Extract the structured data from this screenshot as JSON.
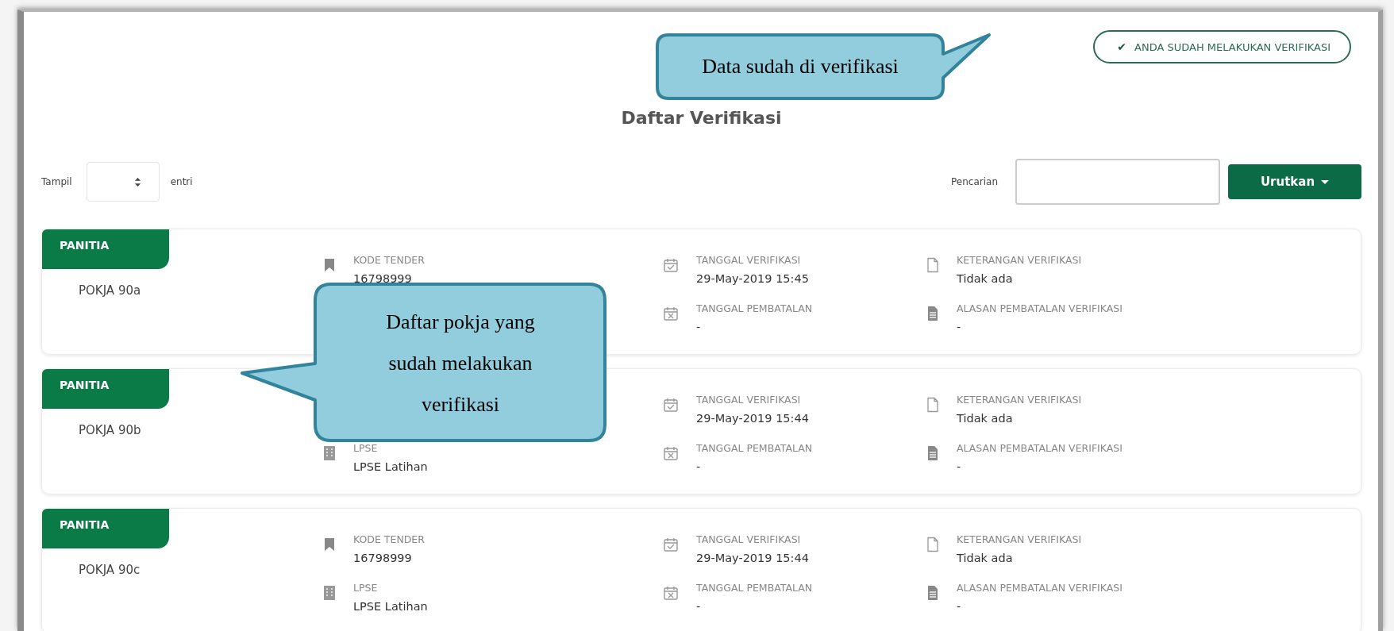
{
  "status_badge": {
    "icon": "✔",
    "label": "ANDA SUDAH MELAKUKAN VERIFIKASI"
  },
  "page_title": "Daftar Verifikasi",
  "length_control": {
    "label_before": "Tampil",
    "label_after": "entri"
  },
  "search": {
    "label": "Pencarian"
  },
  "sort_button": {
    "label": "Urutkan"
  },
  "cards": [
    {
      "group": "PANITIA",
      "name": "POKJA 90a",
      "fields": [
        {
          "kind": "tender",
          "label": "KODE TENDER",
          "value": "16798999"
        },
        {
          "kind": "verified_date",
          "label": "TANGGAL VERIFIKASI",
          "value": "29-May-2019 15:45"
        },
        {
          "kind": "cancel_date",
          "label": "TANGGAL PEMBATALAN",
          "value": "-"
        },
        {
          "kind": "note",
          "label": "KETERANGAN VERIFIKASI",
          "value": "Tidak ada"
        },
        {
          "kind": "cancel_reason",
          "label": "ALASAN PEMBATALAN VERIFIKASI",
          "value": "-"
        }
      ]
    },
    {
      "group": "PANITIA",
      "name": "POKJA 90b",
      "fields": [
        {
          "kind": "lpse",
          "label": "LPSE",
          "value": "LPSE Latihan"
        },
        {
          "kind": "verified_date",
          "label": "TANGGAL VERIFIKASI",
          "value": "29-May-2019 15:44"
        },
        {
          "kind": "cancel_date",
          "label": "TANGGAL PEMBATALAN",
          "value": "-"
        },
        {
          "kind": "note",
          "label": "KETERANGAN VERIFIKASI",
          "value": "Tidak ada"
        },
        {
          "kind": "cancel_reason",
          "label": "ALASAN PEMBATALAN VERIFIKASI",
          "value": "-"
        }
      ]
    },
    {
      "group": "PANITIA",
      "name": "POKJA 90c",
      "fields": [
        {
          "kind": "tender",
          "label": "KODE TENDER",
          "value": "16798999"
        },
        {
          "kind": "lpse",
          "label": "LPSE",
          "value": "LPSE Latihan"
        },
        {
          "kind": "verified_date",
          "label": "TANGGAL VERIFIKASI",
          "value": "29-May-2019 15:44"
        },
        {
          "kind": "cancel_date",
          "label": "TANGGAL PEMBATALAN",
          "value": "-"
        },
        {
          "kind": "note",
          "label": "KETERANGAN VERIFIKASI",
          "value": "Tidak ada"
        },
        {
          "kind": "cancel_reason",
          "label": "ALASAN PEMBATALAN VERIFIKASI",
          "value": "-"
        }
      ]
    }
  ],
  "callouts": [
    {
      "kind": "top",
      "text": "Data sudah di verifikasi"
    },
    {
      "kind": "left",
      "text": "Daftar pokja yang sudah melakukan verifikasi"
    }
  ]
}
